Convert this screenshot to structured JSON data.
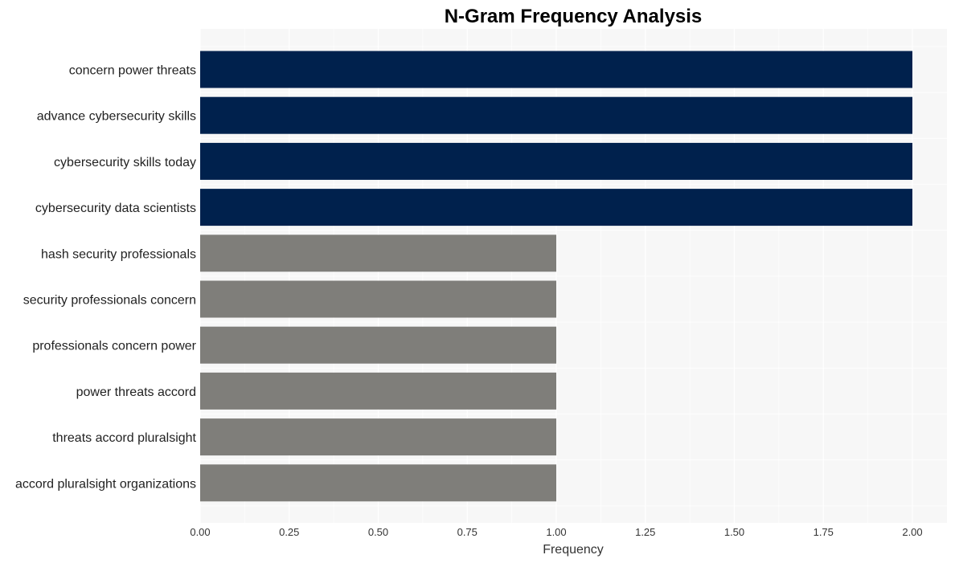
{
  "chart_data": {
    "type": "bar",
    "orientation": "horizontal",
    "title": "N-Gram Frequency Analysis",
    "xlabel": "Frequency",
    "ylabel": "",
    "xlim": [
      0,
      2.1
    ],
    "xticks": [
      0.0,
      0.25,
      0.5,
      0.75,
      1.0,
      1.25,
      1.5,
      1.75,
      2.0
    ],
    "xtick_labels": [
      "0.00",
      "0.25",
      "0.50",
      "0.75",
      "1.00",
      "1.25",
      "1.50",
      "1.75",
      "2.00"
    ],
    "grid": true,
    "categories": [
      "concern power threats",
      "advance cybersecurity skills",
      "cybersecurity skills today",
      "cybersecurity data scientists",
      "hash security professionals",
      "security professionals concern",
      "professionals concern power",
      "power threats accord",
      "threats accord pluralsight",
      "accord pluralsight organizations"
    ],
    "values": [
      2,
      2,
      2,
      2,
      1,
      1,
      1,
      1,
      1,
      1
    ],
    "colors": {
      "highlight": "#00214d",
      "default": "#7f7e7a",
      "plot_background": "#f7f7f7",
      "grid": "#ffffff"
    }
  }
}
